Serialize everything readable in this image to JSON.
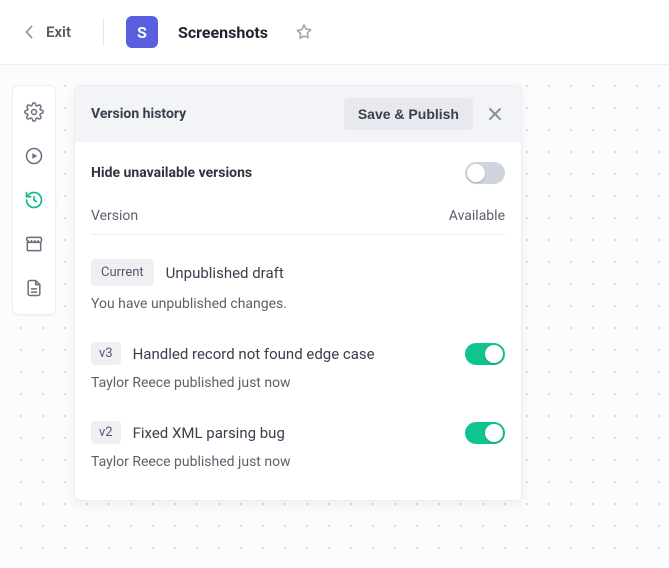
{
  "header": {
    "exit_label": "Exit",
    "app_initial": "S",
    "page_title": "Screenshots"
  },
  "panel": {
    "title": "Version history",
    "save_label": "Save & Publish",
    "hide_label": "Hide unavailable versions",
    "hide_state": "off",
    "columns": {
      "left": "Version",
      "right": "Available"
    },
    "versions": [
      {
        "badge": "Current",
        "title": "Unpublished draft",
        "meta": "You have unpublished changes.",
        "toggle": null
      },
      {
        "badge": "v3",
        "title": "Handled record not found edge case",
        "meta": "Taylor Reece published just now",
        "toggle": "on"
      },
      {
        "badge": "v2",
        "title": "Fixed XML parsing bug",
        "meta": "Taylor Reece published just now",
        "toggle": "on"
      }
    ]
  }
}
